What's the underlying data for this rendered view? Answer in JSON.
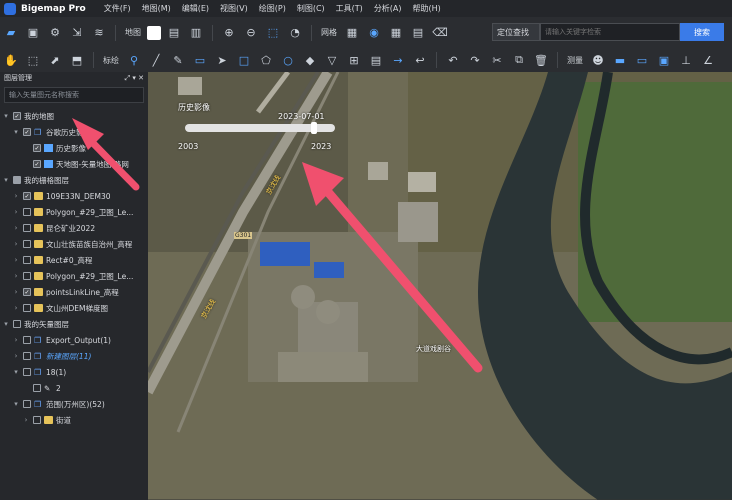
{
  "app": {
    "title": "Bigemap Pro"
  },
  "menu": [
    "文件(F)",
    "地图(M)",
    "编辑(E)",
    "视图(V)",
    "绘图(P)",
    "制图(C)",
    "工具(T)",
    "分析(A)",
    "帮助(H)"
  ],
  "toolbar1": {
    "map_label": "地图",
    "grid_label": "网格"
  },
  "search": {
    "mode": "定位查找",
    "placeholder": "请输入关键字检索",
    "button": "搜索"
  },
  "toolbar2": {
    "label_label": "标绘",
    "measure_label": "测量"
  },
  "panel": {
    "title": "图层管理",
    "search_placeholder": "输入矢量图元名称搜索"
  },
  "tree": [
    {
      "label": "我的地图"
    },
    {
      "label": "谷歌历史影像"
    },
    {
      "label": "历史影像"
    },
    {
      "label": "天地图-矢量地图-路网"
    },
    {
      "label": "我的栅格图层"
    },
    {
      "label": "109E33N_DEM30"
    },
    {
      "label": "Polygon_#29_卫图_Le..."
    },
    {
      "label": "昆仑矿业2022"
    },
    {
      "label": "文山壮族苗族自治州_高程"
    },
    {
      "label": "Rect#0_高程"
    },
    {
      "label": "Polygon_#29_卫图_Le..."
    },
    {
      "label": "pointsLinkLine_高程"
    },
    {
      "label": "文山州DEM梯度图"
    },
    {
      "label": "我的矢量图层"
    },
    {
      "label": "Export_Output(1)"
    },
    {
      "label": "新建图层(11)"
    },
    {
      "label": "18(1)"
    },
    {
      "label": "2"
    },
    {
      "label": "范围(万州区)(52)"
    },
    {
      "label": "街道"
    }
  ],
  "map": {
    "history_label": "历史影像",
    "timeline_date": "2023-07-01",
    "timeline_start": "2003",
    "timeline_end": "2023",
    "road_label_1": "京沈线",
    "road_label_2": "京沈线",
    "road_code": "G301",
    "poi_label": "大道戏剧谷"
  },
  "colors": {
    "accent": "#3a7be8",
    "arrow": "#f0506e"
  }
}
